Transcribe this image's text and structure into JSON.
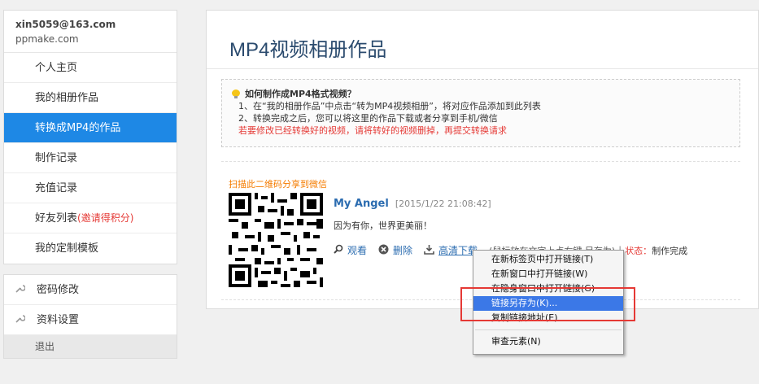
{
  "user": {
    "email": "xin5059@163.com",
    "site": "ppmake.com"
  },
  "nav": {
    "items": [
      {
        "label": "个人主页"
      },
      {
        "label": "我的相册作品"
      },
      {
        "label": "转换成MP4的作品"
      },
      {
        "label": "制作记录"
      },
      {
        "label": "充值记录"
      },
      {
        "label": "好友列表",
        "extra": "(邀请得积分)"
      },
      {
        "label": "我的定制模板"
      }
    ]
  },
  "settings": {
    "password": "密码修改",
    "profile": "资料设置",
    "logout": "退出"
  },
  "main": {
    "title": "MP4视频相册作品",
    "tips": {
      "question": "如何制作成MP4格式视频？",
      "line1": "1、在“我的相册作品”中点击“转为MP4视频相册”，将对应作品添加到此列表",
      "line2": "2、转换完成之后，您可以将这里的作品下载或者分享到手机/微信",
      "warn": "若要修改已经转换好的视频，请将转好的视频删掉，再提交转换请求"
    },
    "share_label": "扫描此二维码分享到微信",
    "work": {
      "title": "My Angel",
      "time": "[2015/1/22 21:08:42]",
      "desc": "因为有你，世界更美丽！",
      "view": "观看",
      "delete": "删除",
      "download": "高清下载",
      "hint": "(鼠标放在文字上点右键,另存为)",
      "separator": "|",
      "status_label": "状态：",
      "status_value": "制作完成"
    }
  },
  "context_menu": {
    "items": [
      "在新标签页中打开链接(T)",
      "在新窗口中打开链接(W)",
      "在隐身窗口中打开链接(G)",
      "链接另存为(K)...",
      "复制链接地址(E)",
      "审查元素(N)"
    ]
  },
  "colors": {
    "accent": "#1e88e5",
    "warn": "#e53935",
    "link": "#2b6cb0",
    "highlight_box": "#e53935"
  }
}
